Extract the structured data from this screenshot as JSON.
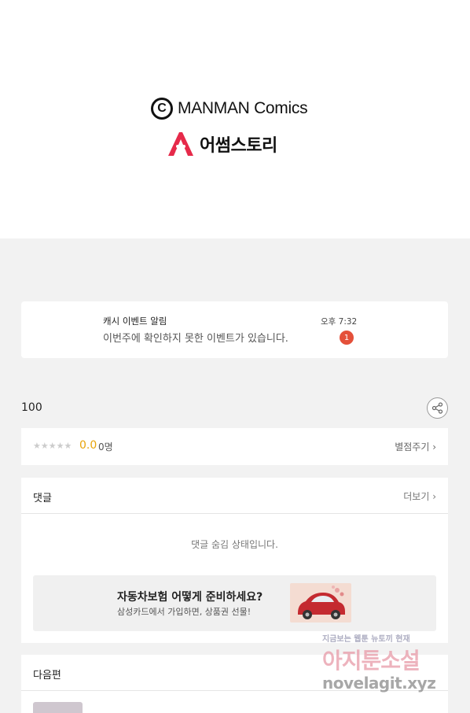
{
  "hero": {
    "publisher_symbol": "C",
    "publisher_name": "MANMAN Comics",
    "studio_name": "어썸스토리"
  },
  "notification": {
    "title": "캐시 이벤트 알림",
    "message": "이번주에 확인하지 못한 이벤트가 있습니다.",
    "time": "오후 7:32",
    "badge_count": "1"
  },
  "episode": {
    "number": "100",
    "share_icon": "share-icon"
  },
  "rating": {
    "stars": "★★★★★",
    "score": "0.0",
    "count": "0명",
    "rate_button": "별점주기 ›"
  },
  "comments": {
    "title": "댓글",
    "more_button": "더보기 ›",
    "hidden_message": "댓글 숨김 상태입니다."
  },
  "ad": {
    "title": "자동차보험 어떻게 준비하세요?",
    "subtitle": "삼성카드에서 가입하면, 상품권 선물!"
  },
  "next_episode": {
    "title": "다음편",
    "partial_text": "..."
  },
  "watermark": {
    "top": "지금보는 웹툰 뉴토끼 현재",
    "mid": "아지툰소설",
    "bottom": "novelagit.xyz"
  },
  "colors": {
    "badge": "#e4503a",
    "score": "#e8a40b",
    "brand_red": "#e62a4a"
  }
}
